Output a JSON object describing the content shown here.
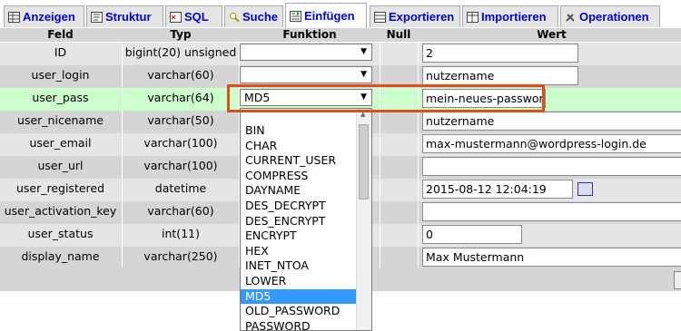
{
  "tabs": [
    {
      "label": "Anzeigen",
      "icon": "table-view-icon",
      "active": false
    },
    {
      "label": "Struktur",
      "icon": "structure-icon",
      "active": false
    },
    {
      "label": "SQL",
      "icon": "sql-icon",
      "active": false
    },
    {
      "label": "Suche",
      "icon": "search-icon",
      "active": false
    },
    {
      "label": "Einfügen",
      "icon": "insert-icon",
      "active": true
    },
    {
      "label": "Exportieren",
      "icon": "export-icon",
      "active": false
    },
    {
      "label": "Importieren",
      "icon": "import-icon",
      "active": false
    },
    {
      "label": "Operationen",
      "icon": "operations-icon",
      "active": false
    }
  ],
  "headers": {
    "feld": "Feld",
    "typ": "Typ",
    "funktion": "Funktion",
    "null": "Null",
    "wert": "Wert"
  },
  "rows": [
    {
      "feld": "ID",
      "typ": "bigint(20) unsigned",
      "funktion": "",
      "wert": "2"
    },
    {
      "feld": "user_login",
      "typ": "varchar(60)",
      "funktion": "",
      "wert": "nutzername"
    },
    {
      "feld": "user_pass",
      "typ": "varchar(64)",
      "funktion": "MD5",
      "wert": "mein-neues-passwort"
    },
    {
      "feld": "user_nicename",
      "typ": "varchar(50)",
      "funktion": "",
      "wert": "nutzername"
    },
    {
      "feld": "user_email",
      "typ": "varchar(100)",
      "funktion": "",
      "wert": "max-mustermann@wordpress-login.de"
    },
    {
      "feld": "user_url",
      "typ": "varchar(100)",
      "funktion": "",
      "wert": ""
    },
    {
      "feld": "user_registered",
      "typ": "datetime",
      "funktion": "",
      "wert": "2015-08-12 12:04:19"
    },
    {
      "feld": "user_activation_key",
      "typ": "varchar(60)",
      "funktion": "",
      "wert": ""
    },
    {
      "feld": "user_status",
      "typ": "int(11)",
      "funktion": "",
      "wert": "0"
    },
    {
      "feld": "display_name",
      "typ": "varchar(250)",
      "funktion": "",
      "wert": "Max Mustermann"
    }
  ],
  "dropdown": {
    "options": [
      "BIN",
      "CHAR",
      "CURRENT_USER",
      "COMPRESS",
      "DAYNAME",
      "DES_DECRYPT",
      "DES_ENCRYPT",
      "ENCRYPT",
      "HEX",
      "INET_NTOA",
      "LOWER",
      "MD5",
      "OLD_PASSWORD",
      "PASSWORD"
    ],
    "selected": "MD5"
  },
  "colors": {
    "highlight_row": "#ccffcc",
    "selection": "#3399ff",
    "annotation": "#d94f1e",
    "tab_text": "#0000cc"
  }
}
